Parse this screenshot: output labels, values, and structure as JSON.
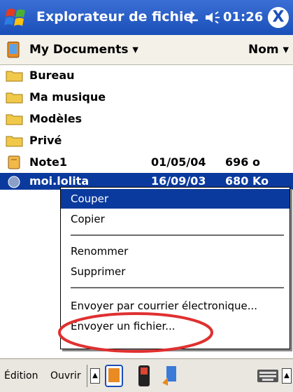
{
  "titlebar": {
    "title": "Explorateur de fichie",
    "clock": "01:26",
    "close_label": "X"
  },
  "folderbar": {
    "folder": "My Documents ▾",
    "sort": "Nom ▾"
  },
  "files": [
    {
      "name": "Bureau",
      "date": "",
      "size": "",
      "icon": "folder-icon"
    },
    {
      "name": "Ma musique",
      "date": "",
      "size": "",
      "icon": "folder-icon"
    },
    {
      "name": "Modèles",
      "date": "",
      "size": "",
      "icon": "folder-icon"
    },
    {
      "name": "Privé",
      "date": "",
      "size": "",
      "icon": "folder-icon"
    },
    {
      "name": "Note1",
      "date": "01/05/04",
      "size": "696 o",
      "icon": "note-icon"
    },
    {
      "name": "moi.lolita",
      "date": "16/09/03",
      "size": "680 Ko",
      "icon": "file-icon"
    }
  ],
  "menu": {
    "cut": "Couper",
    "copy": "Copier",
    "rename": "Renommer",
    "delete": "Supprimer",
    "email": "Envoyer par courrier électronique...",
    "send": "Envoyer un fichier..."
  },
  "toolbar": {
    "edit": "Édition",
    "open": "Ouvrir",
    "up": "▲",
    "kb": "▲"
  },
  "colors": {
    "titlebar": "#1a4fb8",
    "selection": "#0a3a9e",
    "annotation": "#e03030"
  }
}
